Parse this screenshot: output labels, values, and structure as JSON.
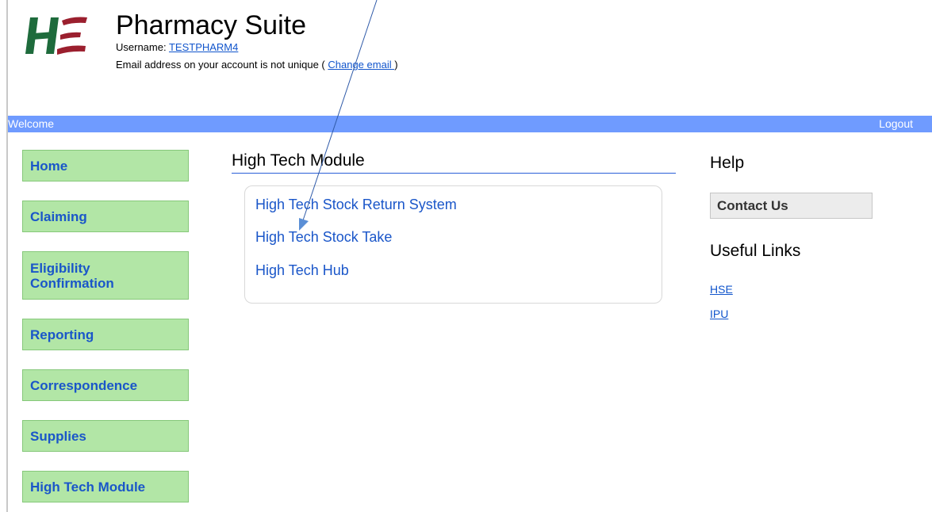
{
  "header": {
    "title": "Pharmacy Suite",
    "username_label": "Username: ",
    "username": "TESTPHARM4",
    "email_notice": "Email address on your account is not unique ( ",
    "change_email": "Change email ",
    "email_close": ")"
  },
  "topbar": {
    "welcome": "Welcome",
    "logout": "Logout"
  },
  "nav": {
    "items": [
      {
        "label": "Home"
      },
      {
        "label": "Claiming"
      },
      {
        "label": "Eligibility Confirmation"
      },
      {
        "label": "Reporting"
      },
      {
        "label": "Correspondence"
      },
      {
        "label": "Supplies"
      },
      {
        "label": "High Tech Module"
      }
    ]
  },
  "main": {
    "title": "High Tech Module",
    "links": [
      {
        "label": "High Tech Stock Return System"
      },
      {
        "label": "High Tech Stock Take"
      },
      {
        "label": "High Tech Hub"
      }
    ]
  },
  "help": {
    "title": "Help",
    "contact_label": "Contact Us",
    "useful_title": "Useful Links",
    "links": [
      {
        "label": "HSE"
      },
      {
        "label": "IPU"
      }
    ]
  },
  "colors": {
    "topbar": "#6f9bff",
    "nav_button": "#b2e6a6",
    "link": "#1a56c9",
    "logo_green": "#1e6b3c",
    "logo_red": "#9b1f2e"
  }
}
